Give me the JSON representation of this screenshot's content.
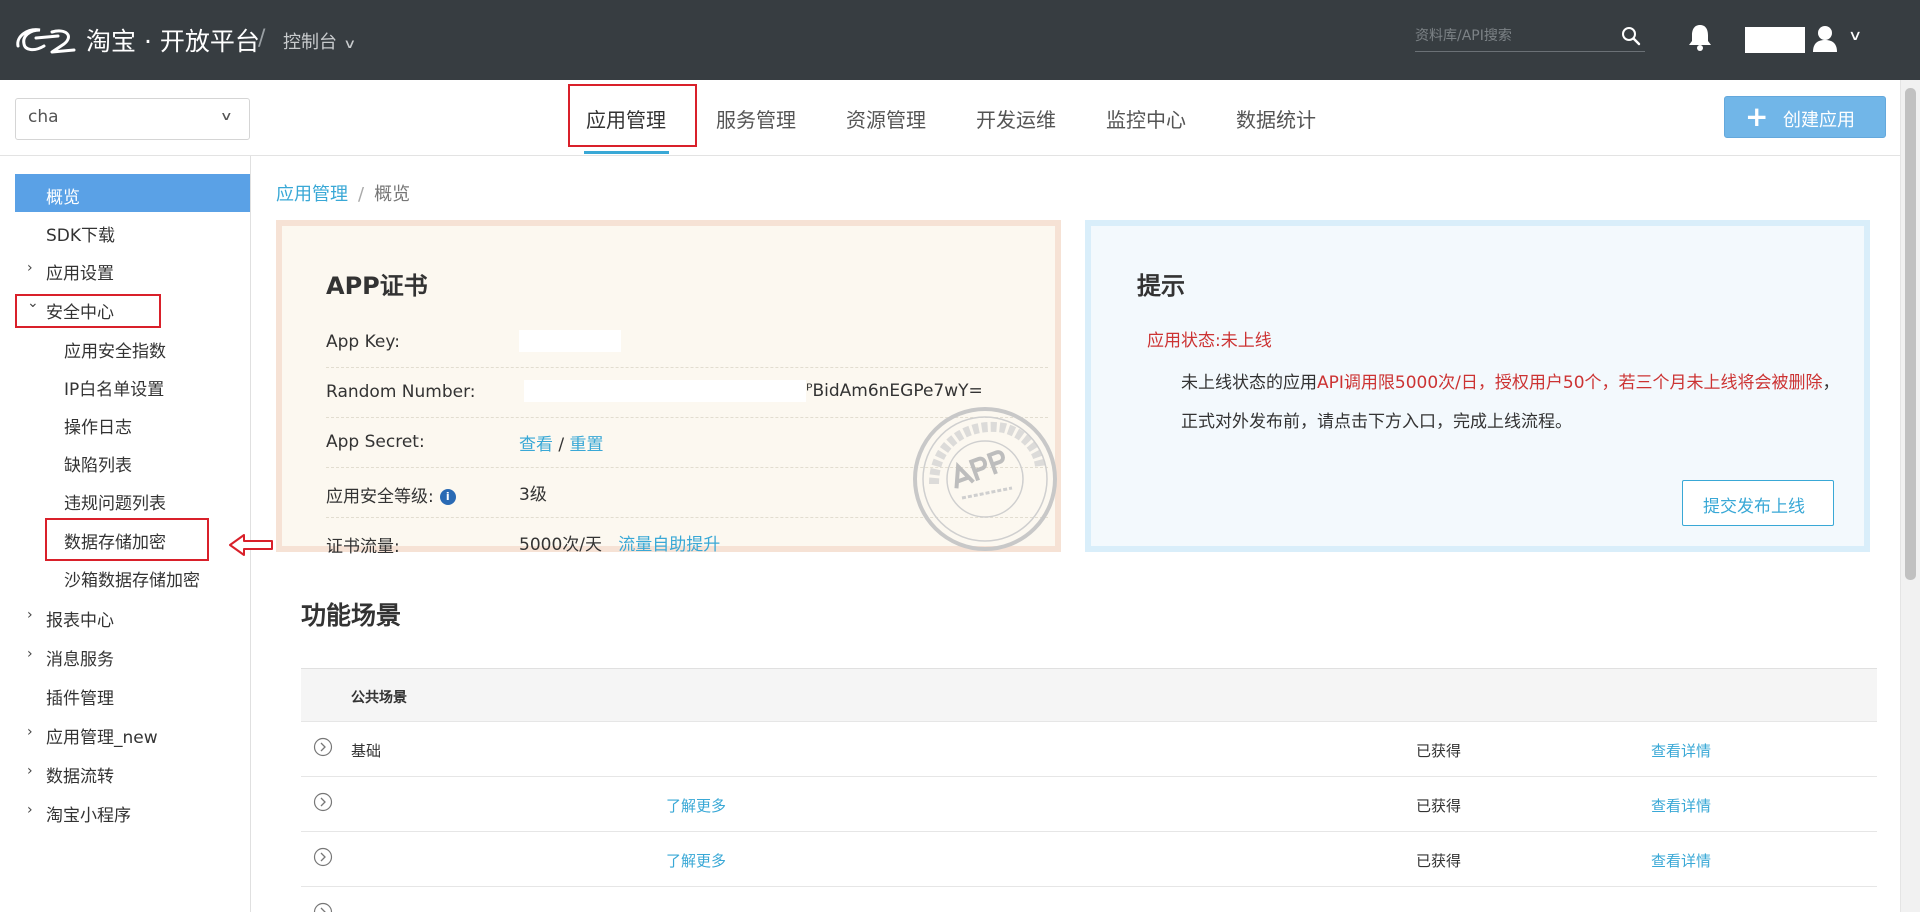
{
  "topbar": {
    "brand": "淘宝 · 开放平台",
    "separator": "/",
    "console": "控制台",
    "search_placeholder": "资料库/API搜索"
  },
  "subheader": {
    "app_select_value": "cha",
    "tabs": [
      {
        "label": "应用管理",
        "active": true
      },
      {
        "label": "服务管理"
      },
      {
        "label": "资源管理"
      },
      {
        "label": "开发运维"
      },
      {
        "label": "监控中心"
      },
      {
        "label": "数据统计"
      }
    ],
    "create_button": "创建应用"
  },
  "sidebar": {
    "items": [
      {
        "label": "概览",
        "active": true
      },
      {
        "label": "SDK下载"
      },
      {
        "label": "应用设置",
        "arrow": "›"
      },
      {
        "label": "安全中心",
        "arrow": "⌄"
      },
      {
        "label": "应用安全指数",
        "sub": true
      },
      {
        "label": "IP白名单设置",
        "sub": true
      },
      {
        "label": "操作日志",
        "sub": true
      },
      {
        "label": "缺陷列表",
        "sub": true
      },
      {
        "label": "违规问题列表",
        "sub": true
      },
      {
        "label": "数据存储加密",
        "sub": true
      },
      {
        "label": "沙箱数据存储加密",
        "sub": true
      },
      {
        "label": "报表中心",
        "arrow": "›"
      },
      {
        "label": "消息服务",
        "arrow": "›"
      },
      {
        "label": "插件管理"
      },
      {
        "label": "应用管理_new",
        "arrow": "›"
      },
      {
        "label": "数据流转",
        "arrow": "›"
      },
      {
        "label": "淘宝小程序",
        "arrow": "›"
      }
    ]
  },
  "breadcrumb": {
    "link": "应用管理",
    "separator": "/",
    "current": "概览"
  },
  "cert": {
    "title": "APP证书",
    "app_key_label": "App Key:",
    "random_label": "Random Number:",
    "random_value": "ᴾBidAm6nEGPe7wY=",
    "secret_label": "App Secret:",
    "secret_view": "查看",
    "secret_slash": "/",
    "secret_reset": "重置",
    "level_label": "应用安全等级:",
    "level_value": "3级",
    "traffic_label": "证书流量:",
    "traffic_value": "5000次/天",
    "traffic_link": "流量自助提升"
  },
  "tip": {
    "title": "提示",
    "status": "应用状态:未上线",
    "msg_1": "未上线状态的应用",
    "msg_2": "API调用限5000次/日，授权用户50个，若三个月未上线将会被删除",
    "msg_3": "，正式对外发布前，请点击下方入口，完成上线流程。",
    "button": "提交发布上线"
  },
  "scenarios": {
    "title": "功能场景",
    "header": "公共场景",
    "rows": [
      {
        "name": "基础",
        "more": "",
        "status": "已获得",
        "detail": "查看详情"
      },
      {
        "name": "",
        "more": "了解更多",
        "status": "已获得",
        "detail": "查看详情"
      },
      {
        "name": "",
        "more": "了解更多",
        "status": "已获得",
        "detail": "查看详情"
      }
    ]
  },
  "colors": {
    "topbar": "#373d41",
    "accent": "#39a8d6",
    "active_nav": "#5aa1e6",
    "highlight": "#d9202a",
    "warning": "#c33"
  }
}
